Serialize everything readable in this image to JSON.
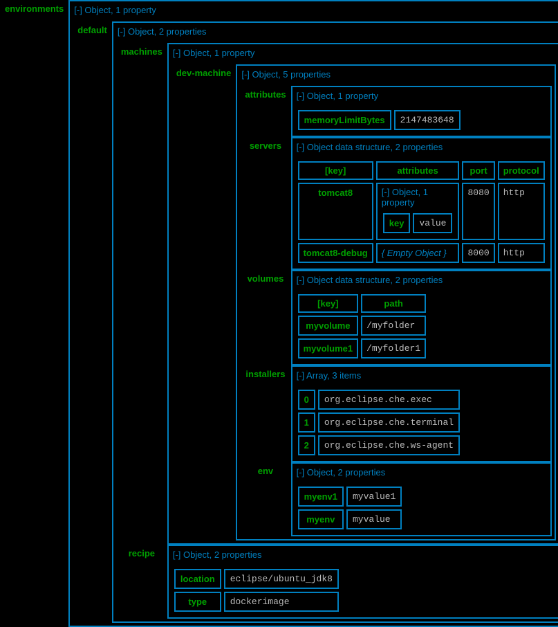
{
  "labels": {
    "obj1prop": "[-] Object, 1 property",
    "obj2prop": "[-] Object, 2 properties",
    "obj5prop": "[-] Object, 5 properties",
    "objds2prop": "[-] Object data structure, 2 properties",
    "arr3items": "[-] Array, 3 items",
    "emptyObj": "{ Empty Object }",
    "keyHeader": "[key]"
  },
  "keys": {
    "environments": "environments",
    "default": "default",
    "machines": "machines",
    "devMachine": "dev-machine",
    "attributes": "attributes",
    "memoryLimitBytes": "memoryLimitBytes",
    "servers": "servers",
    "port": "port",
    "protocol": "protocol",
    "volumes": "volumes",
    "path": "path",
    "installers": "installers",
    "env": "env",
    "recipe": "recipe",
    "location": "location",
    "type": "type",
    "key": "key"
  },
  "values": {
    "memoryLimitBytes": "2147483648",
    "servers": {
      "tomcat8": {
        "name": "tomcat8",
        "attrVal": "value",
        "port": "8080",
        "protocol": "http"
      },
      "tomcat8debug": {
        "name": "tomcat8-debug",
        "port": "8000",
        "protocol": "http"
      }
    },
    "volumes": {
      "myvolume": {
        "name": "myvolume",
        "path": "/myfolder"
      },
      "myvolume1": {
        "name": "myvolume1",
        "path": "/myfolder1"
      }
    },
    "installers": {
      "i0": {
        "idx": "0",
        "val": "org.eclipse.che.exec"
      },
      "i1": {
        "idx": "1",
        "val": "org.eclipse.che.terminal"
      },
      "i2": {
        "idx": "2",
        "val": "org.eclipse.che.ws-agent"
      }
    },
    "env": {
      "myenv1": {
        "name": "myenv1",
        "val": "myvalue1"
      },
      "myenv": {
        "name": "myenv",
        "val": "myvalue"
      }
    },
    "recipe": {
      "location": "eclipse/ubuntu_jdk8",
      "type": "dockerimage"
    }
  }
}
